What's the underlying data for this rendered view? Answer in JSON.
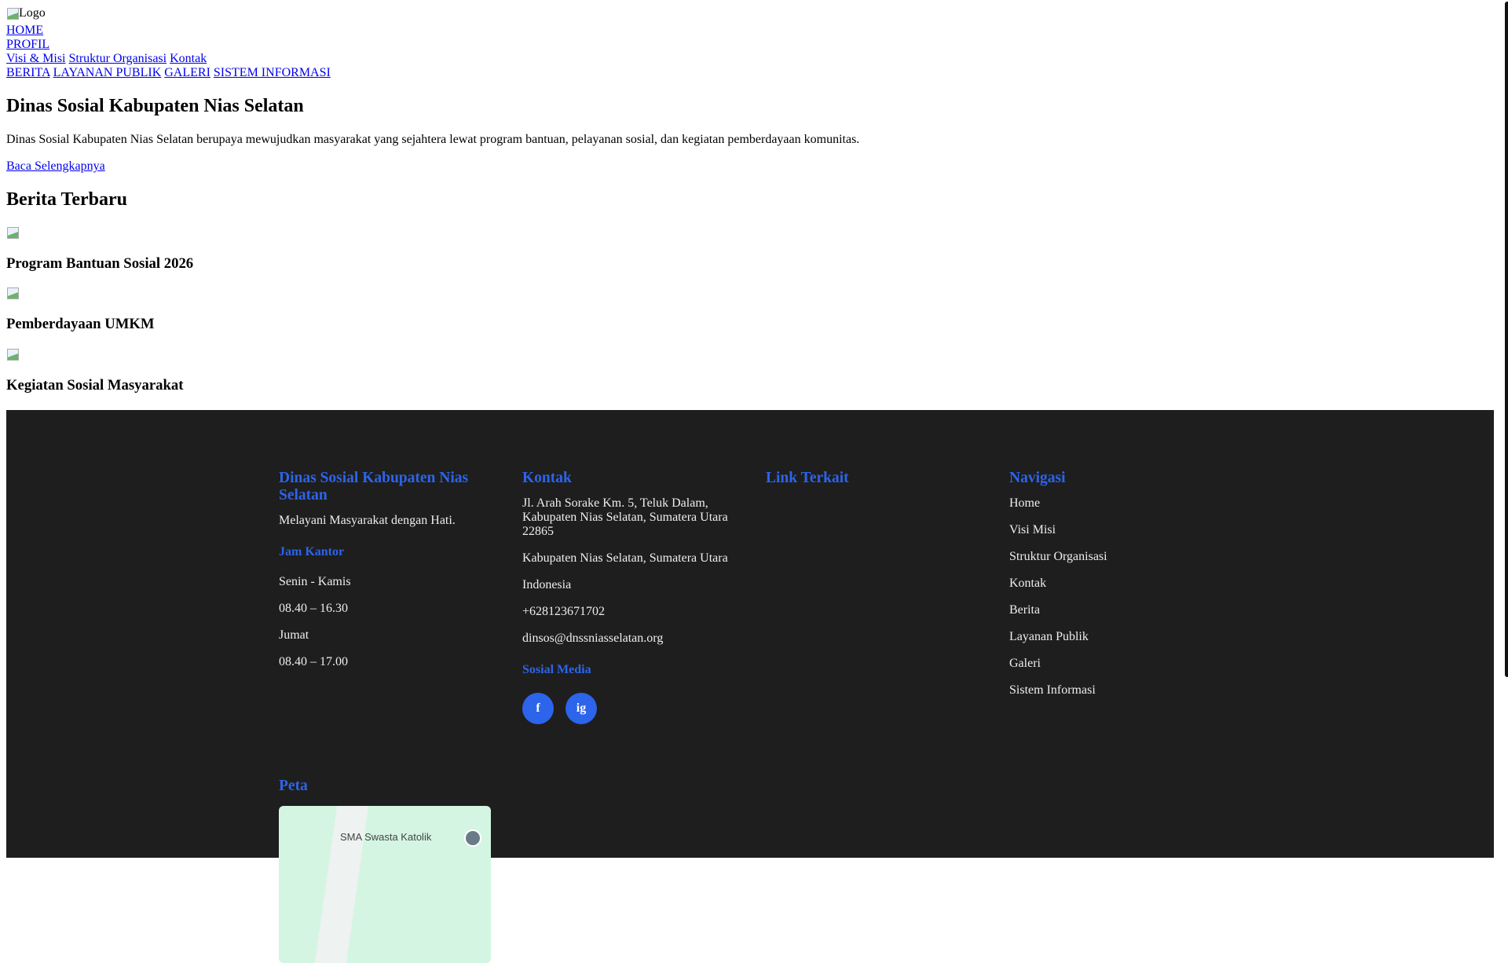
{
  "header": {
    "logo_alt": "Logo",
    "nav": {
      "home": "HOME",
      "profil": "PROFIL",
      "profil_sub": [
        "Visi & Misi",
        "Struktur Organisasi",
        "Kontak"
      ],
      "others": [
        "BERITA",
        "LAYANAN PUBLIK",
        "GALERI",
        "SISTEM INFORMASI"
      ]
    }
  },
  "hero": {
    "title": "Dinas Sosial Kabupaten Nias Selatan",
    "description": "Dinas Sosial Kabupaten Nias Selatan berupaya mewujudkan masyarakat yang sejahtera lewat program bantuan, pelayanan sosial, dan kegiatan pemberdayaan komunitas.",
    "read_more": "Baca Selengkapnya"
  },
  "news": {
    "title": "Berita Terbaru",
    "items": [
      "Program Bantuan Sosial 2026",
      "Pemberdayaan UMKM",
      "Kegiatan Sosial Masyarakat"
    ]
  },
  "footer": {
    "about": {
      "title": "Dinas Sosial Kabupaten Nias Selatan",
      "tagline": "Melayani Masyarakat dengan Hati.",
      "hours_title": "Jam Kantor",
      "hours": [
        "Senin - Kamis",
        "08.40 – 16.30",
        "Jumat",
        "08.40 – 17.00"
      ]
    },
    "contact": {
      "title": "Kontak",
      "address": "Jl. Arah Sorake Km. 5, Teluk Dalam, Kabupaten Nias Selatan, Sumatera Utara 22865",
      "region": "Kabupaten Nias Selatan, Sumatera Utara",
      "country": "Indonesia",
      "phone": "+628123671702",
      "email": "dinsos@dnssniasselatan.org",
      "social_title": "Sosial Media",
      "social": [
        "f",
        "ig"
      ]
    },
    "links": {
      "title": "Link Terkait"
    },
    "navigation": {
      "title": "Navigasi",
      "items": [
        "Home",
        "Visi Misi",
        "Struktur Organisasi",
        "Kontak",
        "Berita",
        "Layanan Publik",
        "Galeri",
        "Sistem Informasi"
      ]
    },
    "map": {
      "title": "Peta",
      "label": "SMA Swasta Katolik"
    }
  },
  "colors": {
    "accent": "#2c64eb",
    "footer_bg": "#1e1e1e"
  }
}
